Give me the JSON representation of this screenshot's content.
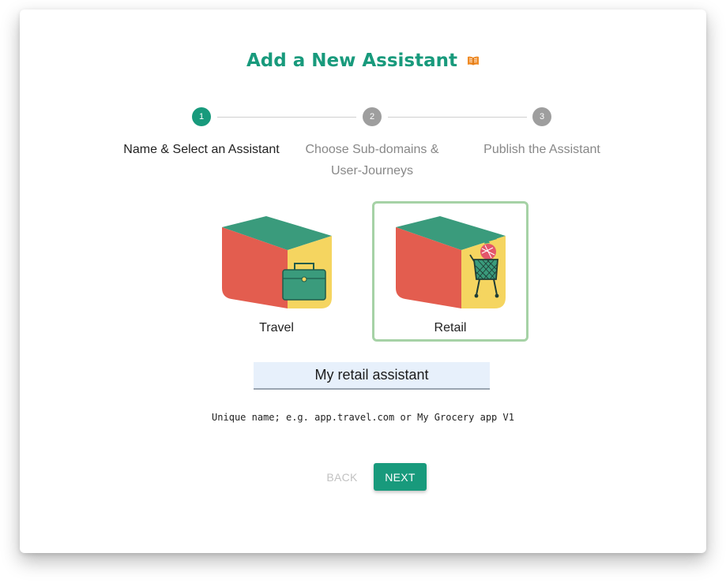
{
  "page": {
    "title": "Add a New Assistant",
    "title_icon": "book-icon",
    "accent_color": "#189a7c"
  },
  "stepper": {
    "steps": [
      {
        "number": "1",
        "label_line1": "Name & Select an Assistant",
        "label_line2": "",
        "state": "active"
      },
      {
        "number": "2",
        "label_line1": "Choose Sub-domains &",
        "label_line2": "User-Journeys",
        "state": "inactive"
      },
      {
        "number": "3",
        "label_line1": "Publish the Assistant",
        "label_line2": "",
        "state": "inactive"
      }
    ]
  },
  "assistants": [
    {
      "label": "Travel",
      "icon": "briefcase-icon",
      "selected": false
    },
    {
      "label": "Retail",
      "icon": "shopping-cart-icon",
      "selected": true
    }
  ],
  "name_field": {
    "value": "My retail assistant",
    "helper": "Unique name; e.g. app.travel.com or My Grocery app V1"
  },
  "actions": {
    "back_label": "BACK",
    "next_label": "NEXT"
  }
}
